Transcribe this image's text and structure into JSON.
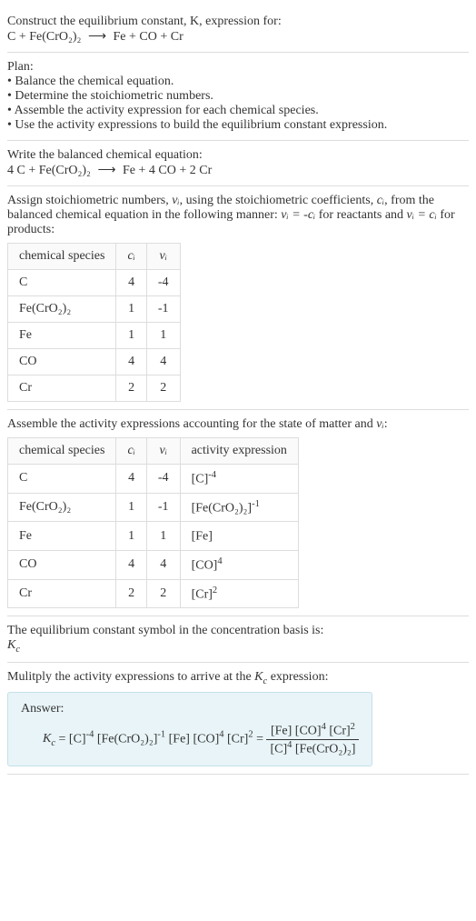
{
  "header": {
    "line1": "Construct the equilibrium constant, K, expression for:",
    "equation_lhs": "C + Fe(CrO₂)₂",
    "arrow": "⟶",
    "equation_rhs": "Fe + CO + Cr"
  },
  "plan": {
    "title": "Plan:",
    "items": [
      "• Balance the chemical equation.",
      "• Determine the stoichiometric numbers.",
      "• Assemble the activity expression for each chemical species.",
      "• Use the activity expressions to build the equilibrium constant expression."
    ]
  },
  "balanced": {
    "title": "Write the balanced chemical equation:",
    "lhs": "4 C + Fe(CrO₂)₂",
    "arrow": "⟶",
    "rhs": "Fe + 4 CO + 2 Cr"
  },
  "stoich": {
    "intro_part1": "Assign stoichiometric numbers, ",
    "nu_i": "νᵢ",
    "intro_part2": ", using the stoichiometric coefficients, ",
    "c_i": "cᵢ",
    "intro_part3": ", from the balanced chemical equation in the following manner: ",
    "relation1": "νᵢ = -cᵢ",
    "intro_part4": " for reactants and ",
    "relation2": "νᵢ = cᵢ",
    "intro_part5": " for products:",
    "headers": {
      "species": "chemical species",
      "ci": "cᵢ",
      "nui": "νᵢ"
    },
    "rows": [
      {
        "species": "C",
        "ci": "4",
        "nui": "-4"
      },
      {
        "species": "Fe(CrO₂)₂",
        "ci": "1",
        "nui": "-1"
      },
      {
        "species": "Fe",
        "ci": "1",
        "nui": "1"
      },
      {
        "species": "CO",
        "ci": "4",
        "nui": "4"
      },
      {
        "species": "Cr",
        "ci": "2",
        "nui": "2"
      }
    ]
  },
  "activity": {
    "intro_part1": "Assemble the activity expressions accounting for the state of matter and ",
    "nu_i": "νᵢ",
    "intro_part2": ":",
    "headers": {
      "species": "chemical species",
      "ci": "cᵢ",
      "nui": "νᵢ",
      "expr": "activity expression"
    },
    "rows": [
      {
        "species": "C",
        "ci": "4",
        "nui": "-4",
        "expr_base": "[C]",
        "expr_exp": "-4"
      },
      {
        "species": "Fe(CrO₂)₂",
        "ci": "1",
        "nui": "-1",
        "expr_base": "[Fe(CrO₂)₂]",
        "expr_exp": "-1"
      },
      {
        "species": "Fe",
        "ci": "1",
        "nui": "1",
        "expr_base": "[Fe]",
        "expr_exp": ""
      },
      {
        "species": "CO",
        "ci": "4",
        "nui": "4",
        "expr_base": "[CO]",
        "expr_exp": "4"
      },
      {
        "species": "Cr",
        "ci": "2",
        "nui": "2",
        "expr_base": "[Cr]",
        "expr_exp": "2"
      }
    ]
  },
  "symbol": {
    "text": "The equilibrium constant symbol in the concentration basis is:",
    "kc": "K",
    "kc_sub": "c"
  },
  "multiply": {
    "text_part1": "Mulitply the activity expressions to arrive at the ",
    "kc": "K",
    "kc_sub": "c",
    "text_part2": " expression:"
  },
  "answer": {
    "label": "Answer:",
    "kc": "K",
    "kc_sub": "c",
    "equals": " = ",
    "t1_base": "[C]",
    "t1_exp": "-4",
    "t2_base": "[Fe(CrO₂)₂]",
    "t2_exp": "-1",
    "t3_base": "[Fe]",
    "t3_exp": "",
    "t4_base": "[CO]",
    "t4_exp": "4",
    "t5_base": "[Cr]",
    "t5_exp": "2",
    "equals2": " = ",
    "num_t1_base": "[Fe]",
    "num_t1_exp": "",
    "num_t2_base": "[CO]",
    "num_t2_exp": "4",
    "num_t3_base": "[Cr]",
    "num_t3_exp": "2",
    "den_t1_base": "[C]",
    "den_t1_exp": "4",
    "den_t2_base": "[Fe(CrO₂)₂]",
    "den_t2_exp": ""
  }
}
